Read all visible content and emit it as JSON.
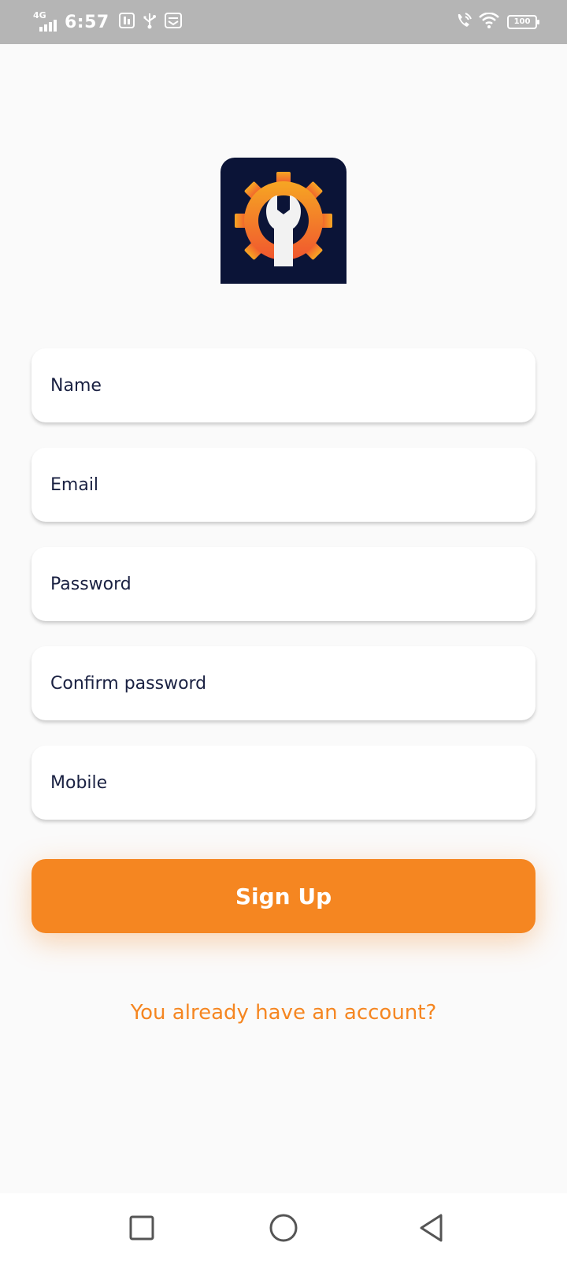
{
  "status_bar": {
    "network": "4G",
    "time": "6:57",
    "battery": "100"
  },
  "form": {
    "name_placeholder": "Name",
    "email_placeholder": "Email",
    "password_placeholder": "Password",
    "confirm_password_placeholder": "Confirm password",
    "mobile_placeholder": "Mobile"
  },
  "actions": {
    "signup_label": "Sign Up",
    "login_link": "You already have an account?"
  },
  "colors": {
    "accent": "#f58621",
    "logo_background": "#0b1437",
    "text": "#1a2142",
    "status_bar": "#b5b5b5",
    "background": "#fafafa"
  },
  "icons": {
    "logo": "gear-wrench-icon",
    "nav_recents": "square-icon",
    "nav_home": "circle-icon",
    "nav_back": "triangle-back-icon"
  }
}
